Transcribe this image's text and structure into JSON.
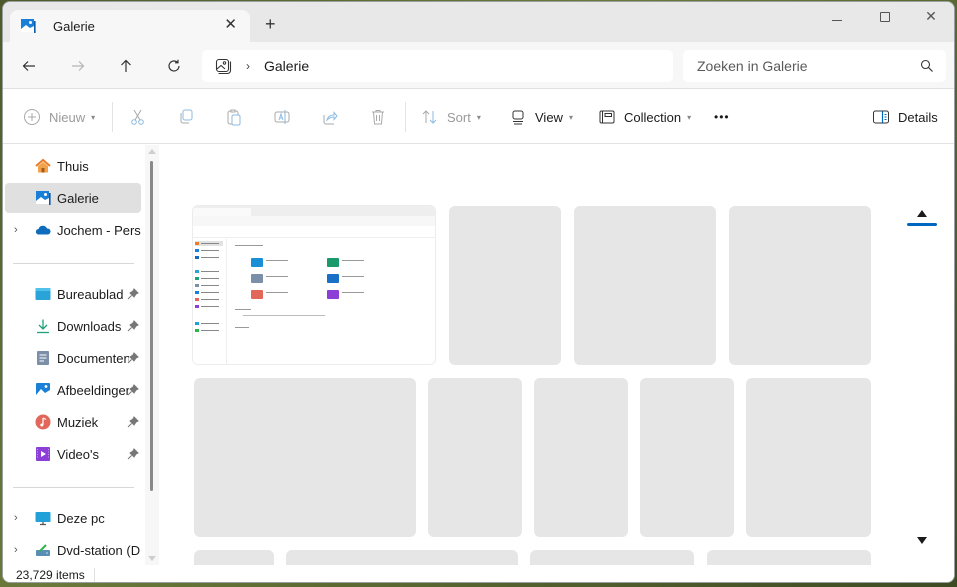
{
  "window": {
    "tab_title": "Galerie",
    "tab_icon": "gallery-icon",
    "new_tab_label": "+",
    "controls": [
      "minimize-icon",
      "maximize-icon",
      "close-icon"
    ]
  },
  "navigation": {
    "back": "back-arrow-icon",
    "forward": "forward-arrow-icon",
    "up": "up-arrow-icon",
    "refresh": "refresh-icon",
    "address": {
      "icon": "gallery-icon",
      "separator": "›",
      "breadcrumb": "Galerie"
    },
    "search": {
      "placeholder": "Zoeken in Galerie",
      "value": ""
    }
  },
  "toolbar": {
    "new_label": "Nieuw",
    "cut": "cut-icon",
    "copy": "copy-icon",
    "paste": "paste-icon",
    "rename": "rename-icon",
    "share": "share-icon",
    "delete": "delete-icon",
    "sort_label": "Sort",
    "view_label": "View",
    "collection_label": "Collection",
    "more_label": "•••",
    "details_label": "Details"
  },
  "sidebar": {
    "items": [
      {
        "label": "Thuis",
        "icon": "home-icon",
        "selected": false,
        "expandable": false,
        "pinned": false
      },
      {
        "label": "Galerie",
        "icon": "gallery-icon",
        "selected": true,
        "expandable": false,
        "pinned": false
      },
      {
        "label": "Jochem - Persoonlijk",
        "icon": "onedrive-cloud-icon",
        "selected": false,
        "expandable": true,
        "pinned": false
      }
    ],
    "quick_access": [
      {
        "label": "Bureaublad",
        "icon": "desktop-icon",
        "pinned": true
      },
      {
        "label": "Downloads",
        "icon": "downloads-icon",
        "pinned": true
      },
      {
        "label": "Documenten",
        "icon": "documents-icon",
        "pinned": true
      },
      {
        "label": "Afbeeldingen",
        "icon": "pictures-icon",
        "pinned": true
      },
      {
        "label": "Muziek",
        "icon": "music-icon",
        "pinned": true
      },
      {
        "label": "Video's",
        "icon": "videos-icon",
        "pinned": true
      }
    ],
    "devices": [
      {
        "label": "Deze pc",
        "icon": "this-pc-icon",
        "expandable": true
      },
      {
        "label": "Dvd-station (D:)",
        "icon": "dvd-drive-icon",
        "expandable": true
      }
    ]
  },
  "gallery": {
    "first_item": "Explorer window screenshot thumbnail",
    "placeholder_color": "#e6e6e6",
    "timeline_accent": "#0067c0"
  },
  "status": {
    "item_count": "23,729 items"
  }
}
